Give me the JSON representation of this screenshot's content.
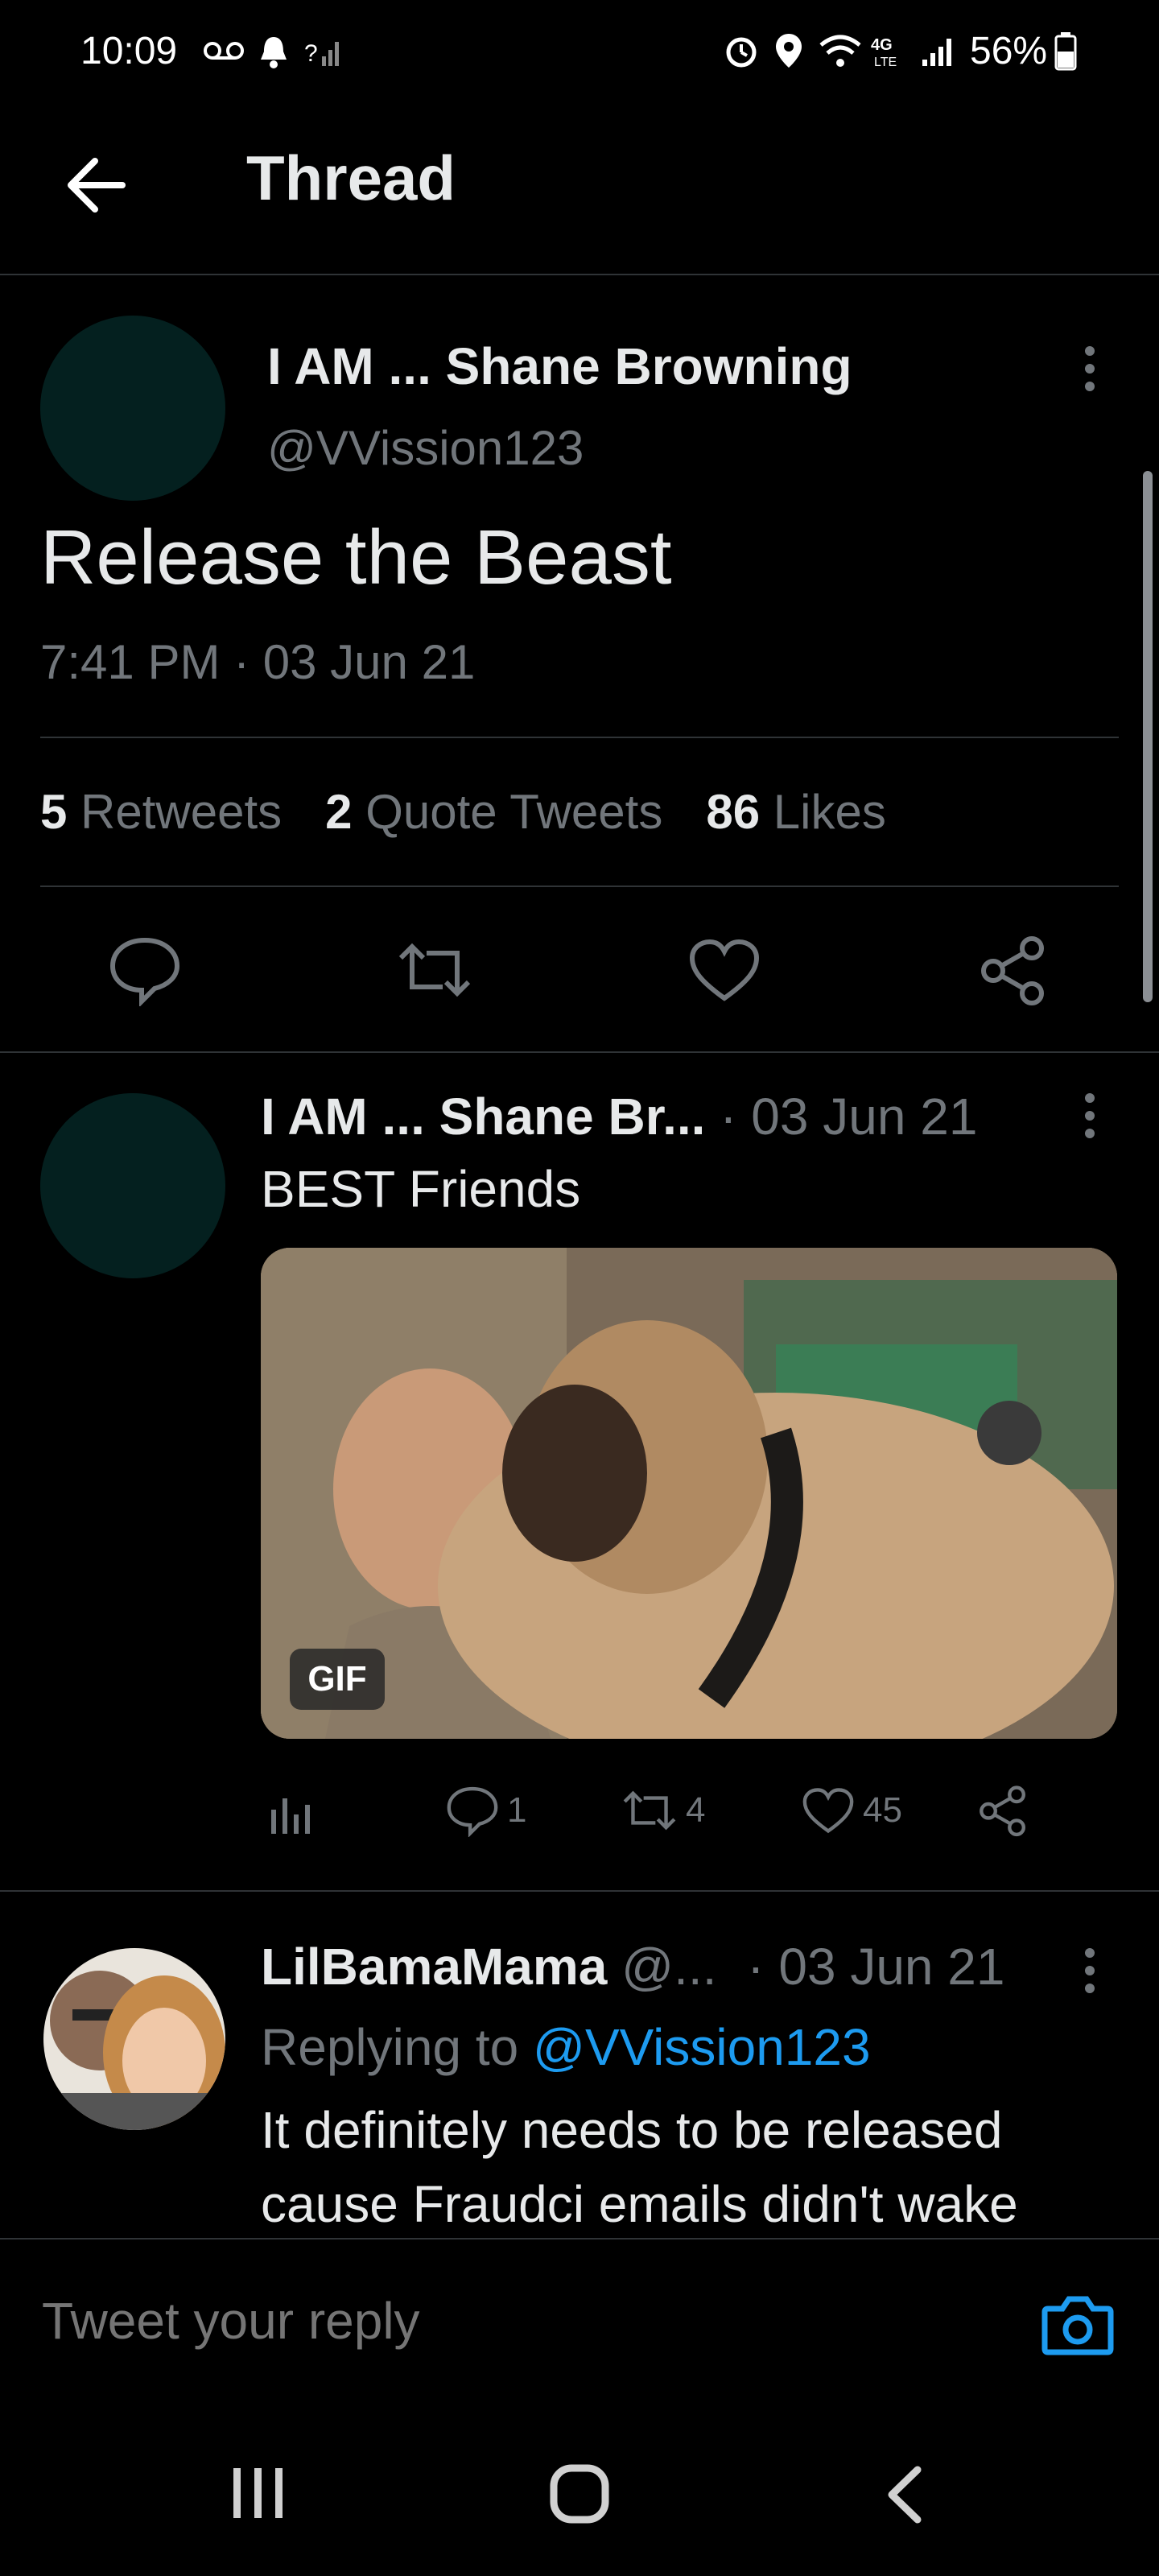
{
  "status_bar": {
    "time": "10:09",
    "battery": "56%"
  },
  "header": {
    "title": "Thread"
  },
  "main_tweet": {
    "display_name": "I AM ... Shane Browning",
    "handle": "@VVission123",
    "text": "Release the Beast",
    "timestamp": "7:41 PM · 03 Jun 21",
    "stats": {
      "retweets_count": "5",
      "retweets_label": "Retweets",
      "quotes_count": "2",
      "quotes_label": "Quote Tweets",
      "likes_count": "86",
      "likes_label": "Likes"
    }
  },
  "reply1": {
    "display_name": "I AM ... Shane Br...",
    "date": "· 03 Jun 21",
    "text": "BEST Friends",
    "gif_label": "GIF",
    "replies": "1",
    "retweets": "4",
    "likes": "45"
  },
  "reply2": {
    "display_name": "LilBamaMama",
    "handle": "@...",
    "date": "· 03 Jun 21",
    "replying_prefix": "Replying to",
    "replying_to": "@VVission123",
    "text": "It definitely needs to be released cause Fraudci emails didn't wake"
  },
  "reply_box": {
    "placeholder": "Tweet your reply"
  },
  "colors": {
    "accent": "#1d9bf0",
    "background": "#000000",
    "muted": "#71767b"
  }
}
